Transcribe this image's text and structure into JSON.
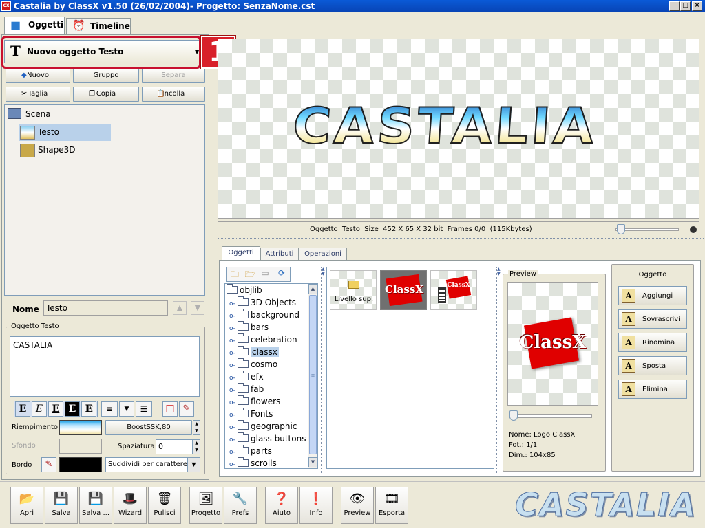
{
  "window": {
    "title": "Castalia by ClassX v1.50 (26/02/2004)- Progetto: SenzaNome.cst",
    "icon_text": "CX",
    "minimize": "_",
    "maximize": "□",
    "close": "×"
  },
  "top_tabs": [
    {
      "label": "Oggetti"
    },
    {
      "label": "Timeline"
    }
  ],
  "new_object": {
    "selected": "Nuovo oggetto Testo",
    "badge": "1",
    "icon": "T"
  },
  "edit_buttons": {
    "nuovo": "Nuovo",
    "gruppo": "Gruppo",
    "separa": "Separa",
    "taglia": "Taglia",
    "copia": "Copia",
    "incolla": "Incolla"
  },
  "scene_tree": {
    "root": "Scena",
    "items": [
      "Testo",
      "Shape3D"
    ]
  },
  "name_field": {
    "label": "Nome",
    "value": "Testo"
  },
  "text_group": {
    "title": "Oggetto Testo",
    "content": "CASTALIA"
  },
  "style": {
    "riempimento_label": "Riempimento",
    "riempimento_value": "BoostSSK,80",
    "sfondo_label": "Sfondo",
    "spaziatura_label": "Spaziatura",
    "spaziatura_value": "0",
    "bordo_label": "Bordo",
    "bordo_mode": "Suddividi per carattere"
  },
  "format_buttons": [
    "E",
    "E",
    "E",
    "E",
    "E"
  ],
  "canvas": {
    "text": "CASTALIA",
    "status": "Oggetto  Testo  Size  452 X 65 X 32 bit  Frames 0/0  (115Kbytes)"
  },
  "lower_tabs": [
    {
      "label": "Oggetti"
    },
    {
      "label": "Attributi"
    },
    {
      "label": "Operazioni"
    }
  ],
  "lib_tree": {
    "root": "objlib",
    "folders": [
      "3D Objects",
      "background",
      "bars",
      "celebration",
      "classx",
      "cosmo",
      "efx",
      "fab",
      "flowers",
      "Fonts",
      "geographic",
      "glass buttons",
      "parts",
      "scrolls"
    ],
    "selected": "classx"
  },
  "thumbnails": [
    {
      "label": "Livello sup."
    },
    {
      "label": "ClassX"
    },
    {
      "label": "ClassX"
    }
  ],
  "preview": {
    "title": "Preview",
    "logo": "ClassX",
    "nome": "Nome: Logo ClassX",
    "fot": "Fot.: 1/1",
    "dim": "Dim.: 104x85"
  },
  "oggetto_ops": {
    "title": "Oggetto",
    "buttons": [
      "Aggiungi",
      "Sovrascrivi",
      "Rinomina",
      "Sposta",
      "Elimina"
    ]
  },
  "bottom_toolbar": [
    "Apri",
    "Salva",
    "Salva ...",
    "Wizard",
    "Pulisci",
    "Progetto",
    "Prefs",
    "Aiuto",
    "Info",
    "Preview",
    "Esporta"
  ],
  "brand_logo": "CASTALIA",
  "colors": {
    "titlebar": "#0a5ad7",
    "highlight": "#d01818",
    "selection": "#b9d1ea"
  }
}
